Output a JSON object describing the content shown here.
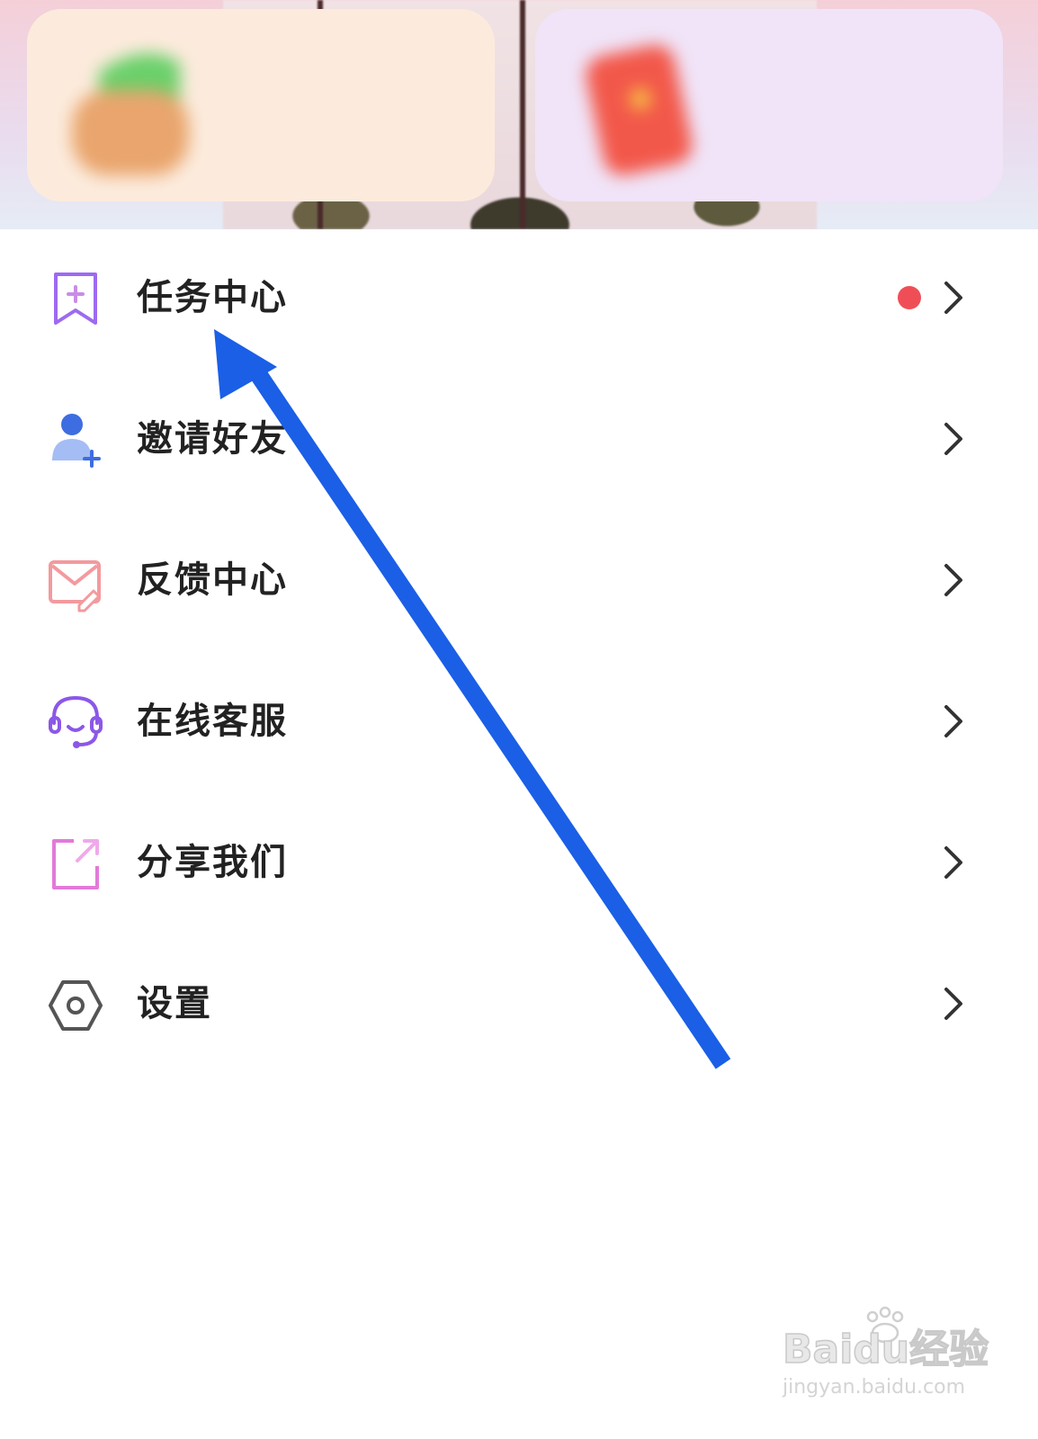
{
  "banner": {
    "cards": [
      {
        "title": "",
        "subtitle": ""
      },
      {
        "title": "",
        "subtitle": ""
      }
    ]
  },
  "menu": {
    "items": [
      {
        "label": "任务中心",
        "icon": "bookmark-plus-icon",
        "color": "#9d6af0",
        "has_dot": true,
        "dot_color": "#f04e57"
      },
      {
        "label": "邀请好友",
        "icon": "add-user-icon",
        "color": "#3d6de0",
        "extra": ""
      },
      {
        "label": "反馈中心",
        "icon": "mail-edit-icon",
        "color": "#f39a9e"
      },
      {
        "label": "在线客服",
        "icon": "headset-icon",
        "color": "#8c57e8"
      },
      {
        "label": "分享我们",
        "icon": "share-icon",
        "color": "#e27ad9"
      },
      {
        "label": "设置",
        "icon": "settings-hexagon-icon",
        "color": "#555555"
      }
    ]
  },
  "annotation": {
    "arrow_color": "#1a5fe6"
  },
  "watermark": {
    "logo": "Baidu经验",
    "url": "jingyan.baidu.com"
  }
}
